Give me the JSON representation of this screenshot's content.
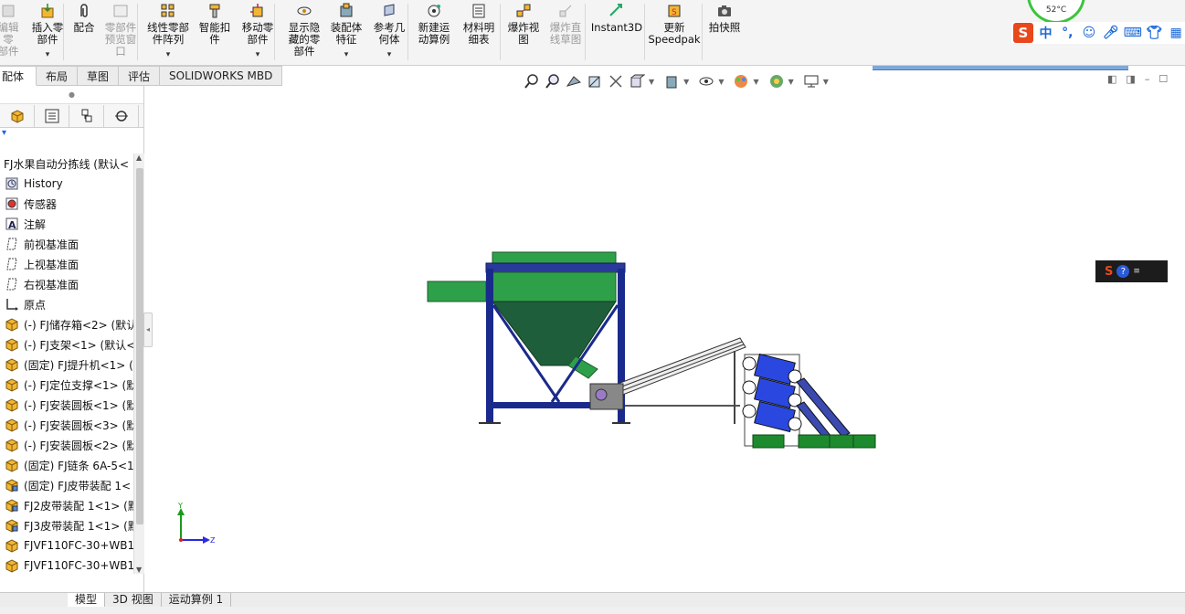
{
  "ribbon": {
    "buttons": [
      {
        "id": "edit-component",
        "label": "编辑零\n部件",
        "icon": "edit-component-icon",
        "disabled": true,
        "dropdown": false
      },
      {
        "id": "insert-component",
        "label": "插入零\n部件",
        "icon": "insert-component-icon",
        "disabled": false,
        "dropdown": true
      },
      {
        "id": "mate",
        "label": "配合",
        "icon": "paperclip-icon",
        "disabled": false,
        "dropdown": false
      },
      {
        "id": "component-preview",
        "label": "零部件\n预览窗\n口",
        "icon": "preview-window-icon",
        "disabled": true,
        "dropdown": false
      },
      {
        "id": "linear-pattern",
        "label": "线性零部\n件阵列",
        "icon": "linear-pattern-icon",
        "disabled": false,
        "dropdown": true
      },
      {
        "id": "smart-fasteners",
        "label": "智能扣\n件",
        "icon": "smart-fastener-icon",
        "disabled": false,
        "dropdown": false
      },
      {
        "id": "move-component",
        "label": "移动零\n部件",
        "icon": "move-component-icon",
        "disabled": false,
        "dropdown": true
      },
      {
        "id": "show-hidden",
        "label": "显示隐\n藏的零\n部件",
        "icon": "show-hidden-icon",
        "disabled": false,
        "dropdown": false
      },
      {
        "id": "assembly-features",
        "label": "装配体\n特征",
        "icon": "assembly-feature-icon",
        "disabled": false,
        "dropdown": true
      },
      {
        "id": "reference-geometry",
        "label": "参考几\n何体",
        "icon": "reference-geometry-icon",
        "disabled": false,
        "dropdown": true
      },
      {
        "id": "new-motion-study",
        "label": "新建运\n动算例",
        "icon": "motion-study-icon",
        "disabled": false,
        "dropdown": false
      },
      {
        "id": "bill-of-materials",
        "label": "材料明\n细表",
        "icon": "bom-icon",
        "disabled": false,
        "dropdown": false
      },
      {
        "id": "exploded-view",
        "label": "爆炸视\n图",
        "icon": "exploded-view-icon",
        "disabled": false,
        "dropdown": false
      },
      {
        "id": "explode-line-sketch",
        "label": "爆炸直\n线草图",
        "icon": "explode-line-icon",
        "disabled": true,
        "dropdown": false
      },
      {
        "id": "instant3d",
        "label": "Instant3D",
        "icon": "instant3d-icon",
        "disabled": false,
        "dropdown": false
      },
      {
        "id": "update-speedpak",
        "label": "更新\nSpeedpak",
        "icon": "speedpak-icon",
        "disabled": false,
        "dropdown": false
      },
      {
        "id": "take-snapshot",
        "label": "拍快照",
        "icon": "camera-icon",
        "disabled": false,
        "dropdown": false
      }
    ]
  },
  "ime": {
    "lang": "中",
    "punct": "°,",
    "temperature": "52°C"
  },
  "command_tabs": [
    {
      "label": "配体",
      "active": true
    },
    {
      "label": "布局",
      "active": false
    },
    {
      "label": "草图",
      "active": false
    },
    {
      "label": "评估",
      "active": false
    },
    {
      "label": "SOLIDWORKS MBD",
      "active": false
    }
  ],
  "tree": {
    "root": "FJ水果自动分拣线  (默认<",
    "items": [
      {
        "label": "History",
        "icon": "history-icon"
      },
      {
        "label": "传感器",
        "icon": "sensor-icon"
      },
      {
        "label": "注解",
        "icon": "annotation-icon"
      },
      {
        "label": "前视基准面",
        "icon": "plane-icon"
      },
      {
        "label": "上视基准面",
        "icon": "plane-icon"
      },
      {
        "label": "右视基准面",
        "icon": "plane-icon"
      },
      {
        "label": "原点",
        "icon": "origin-icon"
      },
      {
        "label": "(-) FJ储存箱<2> (默认",
        "icon": "part-icon"
      },
      {
        "label": "(-) FJ支架<1> (默认<",
        "icon": "part-icon"
      },
      {
        "label": "(固定) FJ提升机<1> (",
        "icon": "part-icon"
      },
      {
        "label": "(-) FJ定位支撑<1> (默",
        "icon": "part-icon"
      },
      {
        "label": "(-) FJ安装圆板<1> (默",
        "icon": "part-icon"
      },
      {
        "label": "(-) FJ安装圆板<3> (默",
        "icon": "part-icon"
      },
      {
        "label": "(-) FJ安装圆板<2> (默",
        "icon": "part-icon"
      },
      {
        "label": "(固定) FJ链条 6A-5<1",
        "icon": "part-icon"
      },
      {
        "label": "(固定) FJ皮带装配 1<",
        "icon": "assembly-icon"
      },
      {
        "label": "FJ2皮带装配 1<1> (默",
        "icon": "assembly-icon"
      },
      {
        "label": "FJ3皮带装配 1<1> (默",
        "icon": "assembly-icon"
      },
      {
        "label": "FJVF110FC-30+WB1",
        "icon": "part-icon"
      },
      {
        "label": "FJVF110FC-30+WB1",
        "icon": "part-icon"
      }
    ]
  },
  "triad": {
    "y": "Y",
    "z": "Z"
  },
  "bottom_tabs": [
    {
      "label": "模型",
      "active": true
    },
    {
      "label": "3D 视图",
      "active": false
    },
    {
      "label": "运动算例 1",
      "active": false
    }
  ],
  "colors": {
    "frame_blue": "#1a2a8c",
    "hopper_green": "#1f5e3a",
    "light_green": "#2fa04a",
    "sorter_blue": "#2a48e0"
  }
}
